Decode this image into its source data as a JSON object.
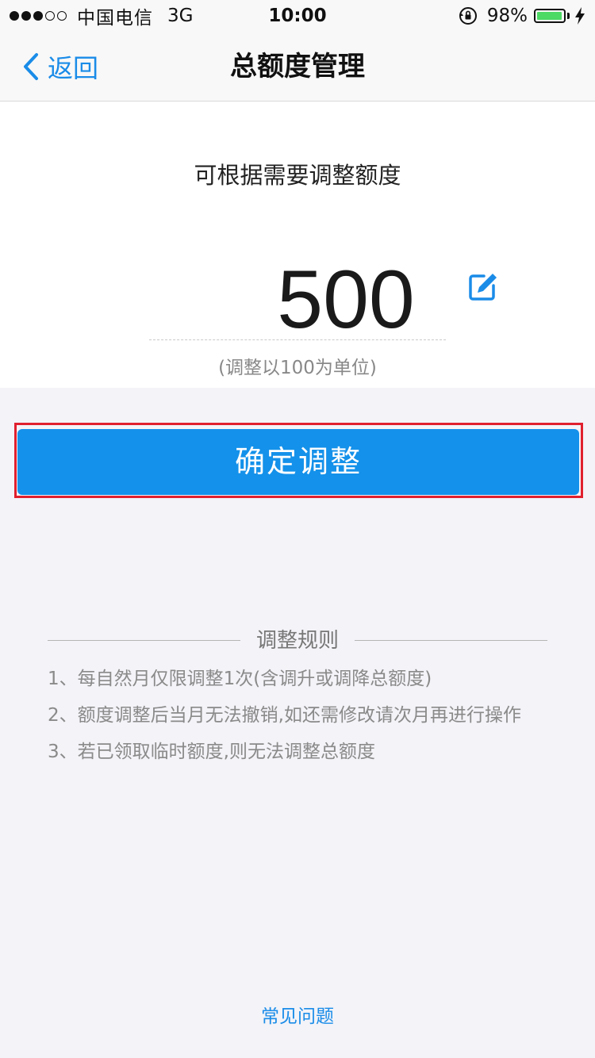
{
  "status_bar": {
    "carrier": "中国电信",
    "network": "3G",
    "time": "10:00",
    "battery_percent": "98%",
    "battery_level": 0.98,
    "battery_color": "#4cd964"
  },
  "nav": {
    "back_label": "返回",
    "title": "总额度管理"
  },
  "amount": {
    "subtitle": "可根据需要调整额度",
    "value": "500",
    "hint": "(调整以100为单位)",
    "edit_icon": "edit-icon"
  },
  "confirm_label": "确定调整",
  "rules": {
    "title": "调整规则",
    "items": [
      "1、每自然月仅限调整1次(含调升或调降总额度)",
      "2、额度调整后当月无法撤销,如还需修改请次月再进行操作",
      "3、若已领取临时额度,则无法调整总额度"
    ]
  },
  "faq_label": "常见问题",
  "colors": {
    "accent": "#1a8ce8",
    "button": "#1491ea",
    "highlight_frame": "#e0202e"
  }
}
